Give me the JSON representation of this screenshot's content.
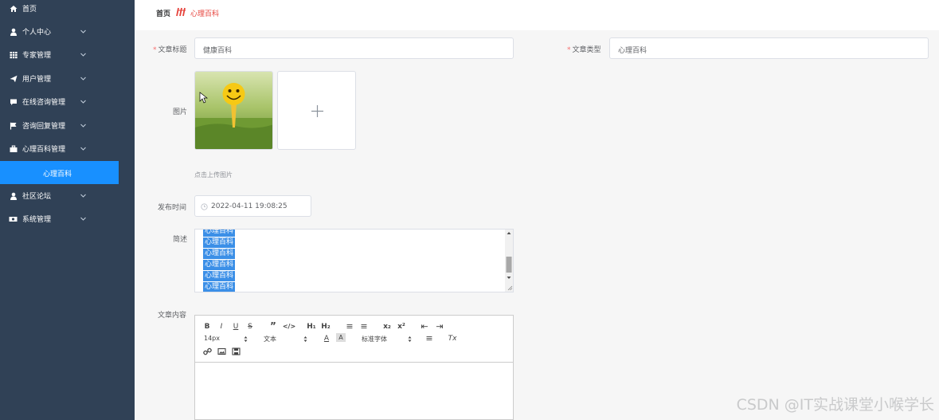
{
  "sidebar": {
    "items": [
      {
        "label": "首页",
        "icon": "home-icon"
      },
      {
        "label": "个人中心",
        "icon": "user-icon"
      },
      {
        "label": "专家管理",
        "icon": "grid-icon"
      },
      {
        "label": "用户管理",
        "icon": "send-icon"
      },
      {
        "label": "在线咨询管理",
        "icon": "chat-icon"
      },
      {
        "label": "咨询回复管理",
        "icon": "flag-icon"
      },
      {
        "label": "心理百科管理",
        "icon": "briefcase-icon"
      },
      {
        "label": "社区论坛",
        "icon": "user-icon"
      },
      {
        "label": "系统管理",
        "icon": "settings-icon"
      }
    ],
    "active_sub": "心理百科"
  },
  "breadcrumb": {
    "home": "首页",
    "current": "心理百科"
  },
  "form": {
    "title_label": "文章标题",
    "title_value": "健康百科",
    "type_label": "文章类型",
    "type_value": "心理百科",
    "image_label": "图片",
    "upload_tip": "点击上传图片",
    "time_label": "发布时间",
    "time_value": "2022-04-11 19:08:25",
    "summary_label": "简述",
    "summary_lines": [
      "心理百科",
      "心理百科",
      "心理百科",
      "心理百科",
      "心理百科",
      "心理百科"
    ],
    "content_label": "文章内容"
  },
  "editor": {
    "font_size": "14px",
    "header_type": "文本",
    "font_family": "标准字体"
  },
  "watermark": "CSDN @IT实战课堂小喉学长",
  "colors": {
    "sidebar_bg": "#304156",
    "active_bg": "#1890ff",
    "breadcrumb_accent": "#e6413a"
  }
}
